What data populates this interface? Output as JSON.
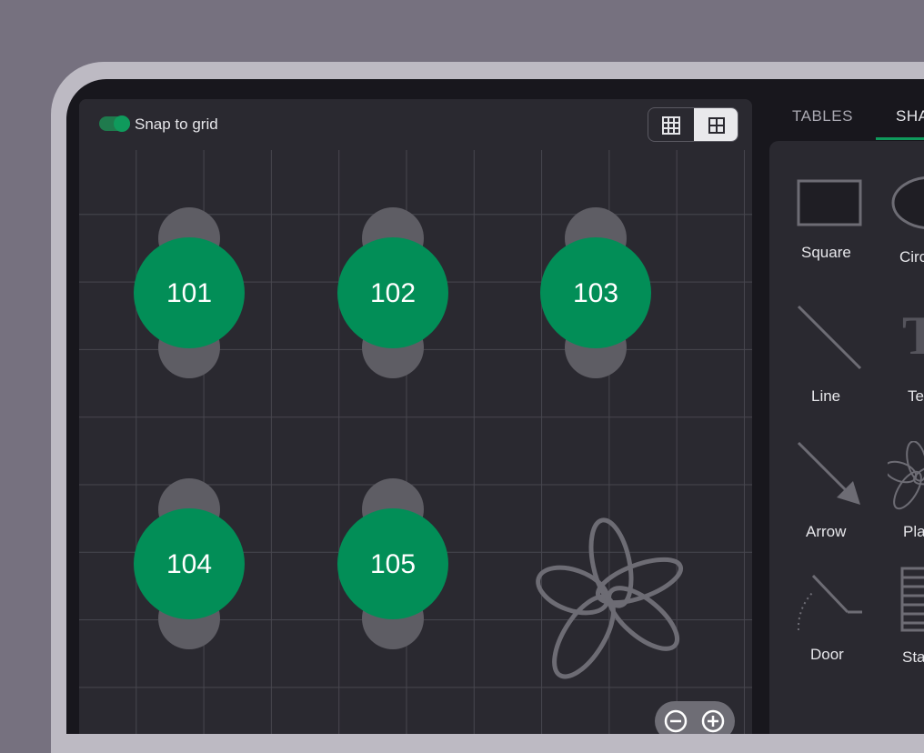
{
  "canvas": {
    "snap_label": "Snap to grid",
    "snap_enabled": true,
    "view_options": [
      "fine-grid-icon",
      "coarse-grid-icon"
    ],
    "active_view": "coarse-grid-icon",
    "tables": [
      {
        "number": "101"
      },
      {
        "number": "102"
      },
      {
        "number": "103"
      },
      {
        "number": "104"
      },
      {
        "number": "105"
      }
    ],
    "decoration": "plant-icon",
    "zoom_controls": [
      "zoom-out-icon",
      "zoom-in-icon"
    ]
  },
  "sidebar": {
    "tabs": [
      "TABLES",
      "SHA"
    ],
    "active_tab": "SHA",
    "shapes": [
      {
        "label": "Square"
      },
      {
        "label": "Circ"
      },
      {
        "label": "Line"
      },
      {
        "label": "Te"
      },
      {
        "label": "Arrow"
      },
      {
        "label": "Pla"
      },
      {
        "label": "Door"
      },
      {
        "label": "Sta"
      }
    ]
  },
  "colors": {
    "accent": "#0f9a5c",
    "table_fill": "#028e57",
    "chair_fill": "#5e5d64",
    "background": "#2a2930",
    "frame": "#76717f"
  }
}
